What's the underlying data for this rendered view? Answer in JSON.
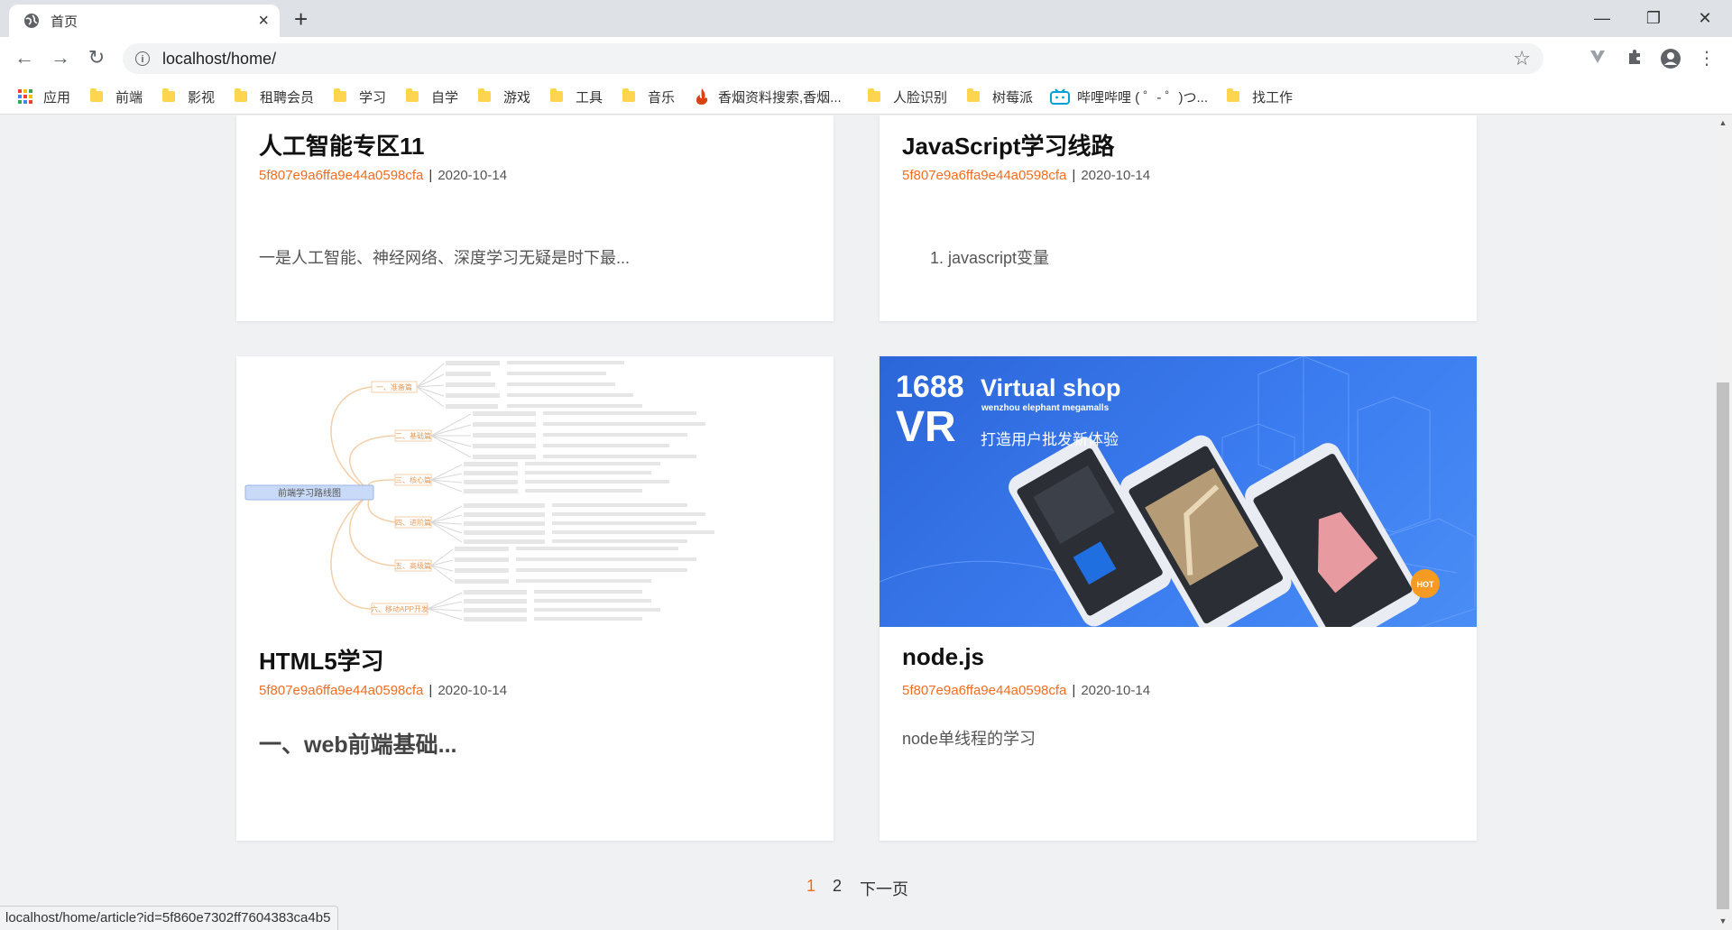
{
  "browser": {
    "tab_title": "首页",
    "url": "localhost/home/",
    "status_url": "localhost/home/article?id=5f860e7302ff7604383ca4b5"
  },
  "bookmarks": [
    {
      "label": "应用",
      "icon": "apps-icon"
    },
    {
      "label": "前端",
      "icon": "folder-icon"
    },
    {
      "label": "影视",
      "icon": "folder-icon"
    },
    {
      "label": "租聘会员",
      "icon": "folder-icon"
    },
    {
      "label": "学习",
      "icon": "folder-icon"
    },
    {
      "label": "自学",
      "icon": "folder-icon"
    },
    {
      "label": "游戏",
      "icon": "folder-icon"
    },
    {
      "label": "工具",
      "icon": "folder-icon"
    },
    {
      "label": "音乐",
      "icon": "folder-icon"
    },
    {
      "label": "香烟资料搜索,香烟...",
      "icon": "flame-icon"
    },
    {
      "label": "人脸识别",
      "icon": "folder-icon"
    },
    {
      "label": "树莓派",
      "icon": "folder-icon"
    },
    {
      "label": "哔哩哔哩 ( ゜- ゜)つ...",
      "icon": "bilibili-icon"
    },
    {
      "label": "找工作",
      "icon": "folder-icon"
    }
  ],
  "articles": [
    {
      "title": "人工智能专区11",
      "author_id": "5f807e9a6ffa9e44a0598cfa",
      "separator": "|",
      "date": "2020-10-14",
      "excerpt": "一是人工智能、神经网络、深度学习无疑是时下最..."
    },
    {
      "title": "JavaScript学习线路",
      "author_id": "5f807e9a6ffa9e44a0598cfa",
      "separator": "|",
      "date": "2020-10-14",
      "excerpt": "1. javascript变量"
    },
    {
      "title": "HTML5学习",
      "author_id": "5f807e9a6ffa9e44a0598cfa",
      "separator": "|",
      "date": "2020-10-14",
      "excerpt": "一、web前端基础...",
      "thumbnail": {
        "center_label": "前端学习路线图",
        "branches": [
          "一、准备篇",
          "二、基础篇",
          "三、核心篇",
          "四、进阶篇",
          "五、高级篇",
          "六、移动APP开发"
        ]
      }
    },
    {
      "title": "node.js",
      "author_id": "5f807e9a6ffa9e44a0598cfa",
      "separator": "|",
      "date": "2020-10-14",
      "excerpt": "node单线程的学习",
      "thumbnail": {
        "line1": "1688",
        "line2": "VR",
        "headline": "Virtual shop",
        "subline": "wenzhou elephant megamalls",
        "tagline": "打造用户批发新体验",
        "badge": "HOT",
        "bg_color": "#2f6fe0"
      }
    }
  ],
  "pagination": {
    "current": "1",
    "page2": "2",
    "next": "下一页",
    "current_color": "#f26d21"
  },
  "colors": {
    "accent": "#f26d21"
  }
}
